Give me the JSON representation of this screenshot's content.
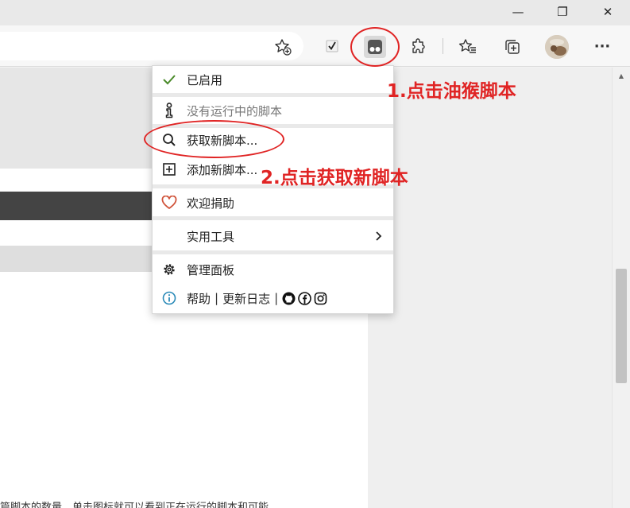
{
  "window": {
    "minimize_glyph": "—",
    "restore_glyph": "❐",
    "close_glyph": "✕"
  },
  "toolbar": {
    "icons": [
      "favorite-add-icon",
      "checkmark-extension-icon",
      "tampermonkey-icon",
      "extensions-icon",
      "favorites-icon",
      "collections-icon",
      "profile-avatar",
      "more-icon"
    ],
    "more_glyph": "···"
  },
  "menu": {
    "enabled_label": "已启用",
    "no_scripts_label": "没有运行中的脚本",
    "get_new_label": "获取新脚本...",
    "add_new_label": "添加新脚本...",
    "donate_label": "欢迎捐助",
    "utilities_label": "实用工具",
    "dashboard_label": "管理面板",
    "help_label": "帮助",
    "pipe": "|",
    "changelog_label": "更新日志",
    "social_icons": [
      "github-icon",
      "facebook-icon",
      "instagram-icon"
    ]
  },
  "annotations": {
    "step1": "1.点击油猴脚本",
    "step2": "2.点击获取新脚本"
  },
  "page": {
    "bottom_text": "篇脚本的数量，单击图标就可以看到正在运行的脚本和可能"
  },
  "colors": {
    "annotation_red": "#e02424",
    "check_green": "#4a8a2a",
    "heart_red": "#d0533a",
    "info_blue": "#2a8ab8"
  }
}
